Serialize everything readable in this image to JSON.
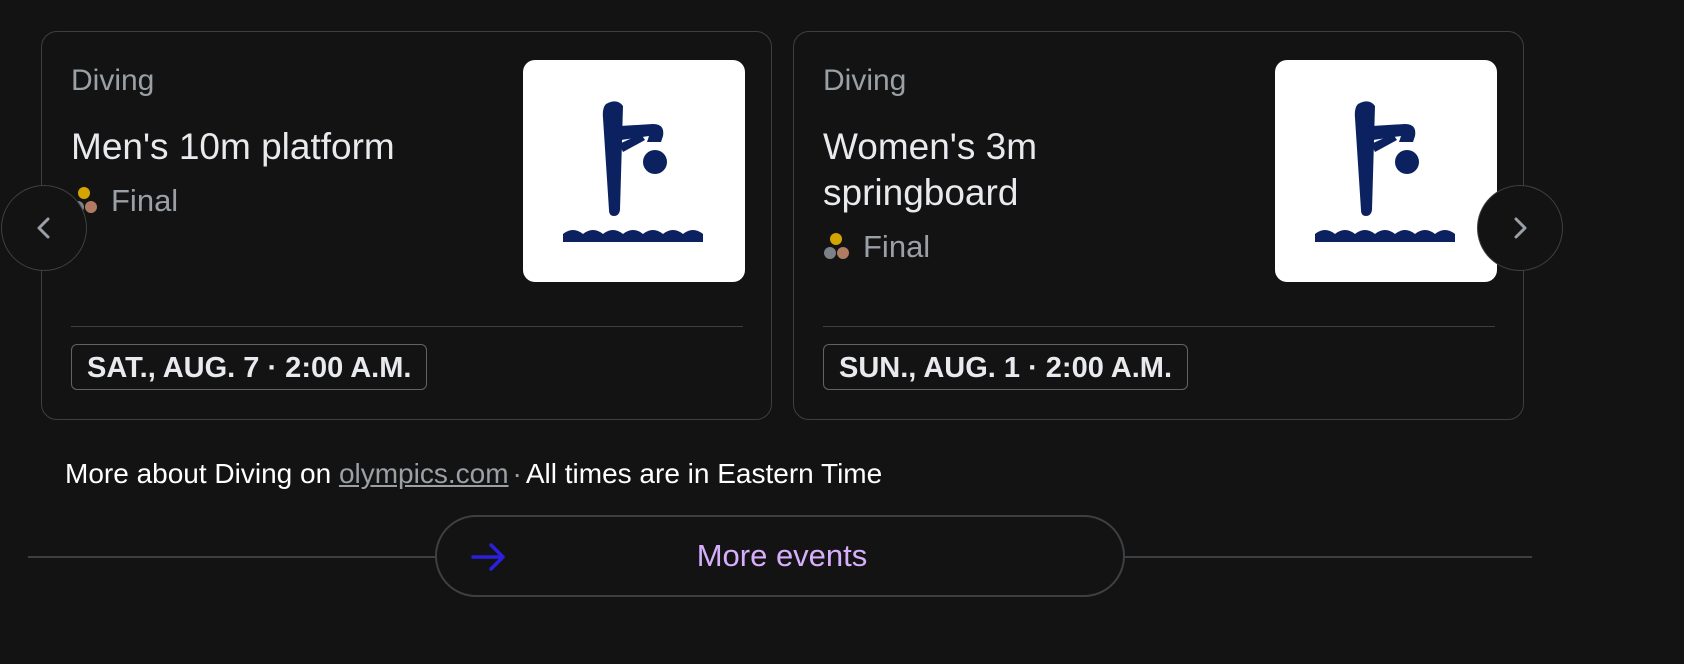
{
  "events": [
    {
      "sport": "Diving",
      "title": "Men's 10m platform",
      "phase": "Final",
      "pictogram_icon": "diving-pictogram-icon",
      "datetime": "SAT., AUG. 7 · 2:00 A.M."
    },
    {
      "sport": "Diving",
      "title": "Women's 3m springboard",
      "phase": "Final",
      "pictogram_icon": "diving-pictogram-icon",
      "datetime": "SUN., AUG. 1 · 2:00 A.M."
    }
  ],
  "footer": {
    "prefix": "More about Diving on",
    "link": "olympics.com",
    "separator": "·",
    "suffix": "All times are in Eastern Time"
  },
  "more_button": {
    "label": "More events",
    "icon": "arrow-right-icon"
  },
  "nav": {
    "prev_icon": "chevron-left-icon",
    "next_icon": "chevron-right-icon"
  },
  "colors": {
    "background": "#131313",
    "pictogram": "#0b2160",
    "link_accent": "#d7aefb",
    "arrow": "#2b1fe0",
    "medal_gold": "#d4a400",
    "medal_silver": "#7d8187",
    "medal_bronze": "#b07a63"
  }
}
